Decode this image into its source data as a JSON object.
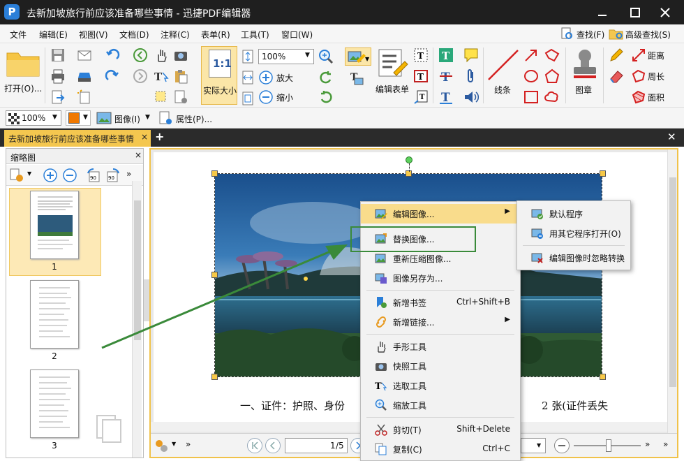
{
  "window": {
    "title": "去新加坡旅行前应该准备哪些事情 - 迅捷PDF编辑器",
    "logo_text": "P"
  },
  "menubar": {
    "items": [
      "文件",
      "编辑(E)",
      "视图(V)",
      "文档(D)",
      "注释(C)",
      "表单(R)",
      "工具(T)",
      "窗口(W)"
    ],
    "find_label": "查找(F)",
    "advanced_find_label": "高级查找(S)"
  },
  "ribbon": {
    "open_label": "打开(O)...",
    "actual_size_label": "实际大小",
    "actual_size_glyph": "1:1",
    "zoom_value": "100%",
    "zoom_in_label": "放大",
    "zoom_out_label": "缩小",
    "edit_form_label": "编辑表单",
    "line_label": "线条",
    "stamp_label": "图章",
    "distance_label": "距离",
    "perimeter_label": "周长",
    "area_label": "面积"
  },
  "toolbar2": {
    "opacity_value": "100%",
    "image_label": "图像(I)",
    "properties_label": "属性(P)..."
  },
  "doc_tab": {
    "label": "去新加坡旅行前应该准备哪些事情",
    "close": "×"
  },
  "thumbnails": {
    "title": "缩略图",
    "pages": [
      "1",
      "2",
      "3"
    ]
  },
  "document": {
    "body_text_left": "一、证件：护照、身份",
    "body_text_right": "2 张(证件丢失"
  },
  "statusbar": {
    "page_value": "1",
    "page_total": "/5"
  },
  "context_menu": {
    "items": [
      {
        "label": "编辑图像...",
        "shortcut": "",
        "submenu": true
      },
      {
        "label": "替换图像...",
        "shortcut": "",
        "submenu": false
      },
      {
        "label": "重新压缩图像...",
        "shortcut": "",
        "submenu": false
      },
      {
        "label": "图像另存为...",
        "shortcut": "",
        "submenu": false
      },
      {
        "label": "新增书签",
        "shortcut": "Ctrl+Shift+B",
        "submenu": false
      },
      {
        "label": "新增链接...",
        "shortcut": "",
        "submenu": true
      },
      {
        "label": "手形工具",
        "shortcut": "",
        "submenu": false
      },
      {
        "label": "快照工具",
        "shortcut": "",
        "submenu": false
      },
      {
        "label": "选取工具",
        "shortcut": "",
        "submenu": false
      },
      {
        "label": "缩放工具",
        "shortcut": "",
        "submenu": false
      },
      {
        "label": "剪切(T)",
        "shortcut": "Shift+Delete",
        "submenu": false
      },
      {
        "label": "复制(C)",
        "shortcut": "Ctrl+C",
        "submenu": false
      }
    ]
  },
  "submenu": {
    "items": [
      "默认程序",
      "用其它程序打开(O)",
      "编辑图像时忽略转换"
    ]
  },
  "colors": {
    "accent": "#f0c24a",
    "highlight_green": "#3a8a3a",
    "title_bg": "#1f1f1f"
  }
}
